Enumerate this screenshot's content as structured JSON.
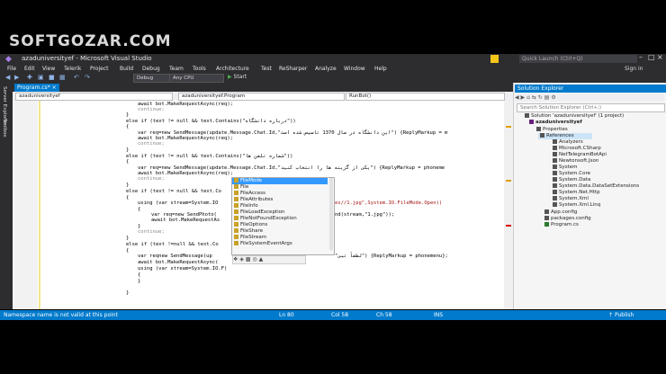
{
  "watermark": "SOFTGOZAR.COM",
  "window": {
    "title": "azaduniversityef - Microsoft Visual Studio",
    "quick_launch_placeholder": "Quick Launch (Ctrl+Q)",
    "sign_in": "Sign in"
  },
  "menu": [
    "File",
    "Edit",
    "View",
    "Telerik",
    "Project",
    "Build",
    "Debug",
    "Team",
    "Tools",
    "Architecture",
    "Test",
    "ReSharper",
    "Analyze",
    "Window",
    "Help"
  ],
  "toolbar": {
    "config": "Debug",
    "platform": "Any CPU",
    "start": "Start"
  },
  "side_tabs": [
    "Server Explorer",
    "Toolbox"
  ],
  "doc_tab": "Program.cs*",
  "nav": {
    "project": "azaduniversityef",
    "type": "azaduniversityef.Program",
    "member": "RunBot()"
  },
  "code_lines": [
    "await bot.MakeRequestAsync(req);",
    "continue;",
    "}",
    "else if (text != null && text.Contains(\"درباره دانشگاه\"))",
    "{",
    "var req=new SendMessage(update.Message.Chat.Id,\"این دانشگاه در سال 1370 تاسیس شده است\") {ReplyMarkup = m",
    "await bot.MakeRequestAsync(req);",
    "continue;",
    "}",
    "else if (text != null && text.Contains(\"شماره تلفن ها\"))",
    "{",
    "var req=new SendMessage(update.Message.Chat.Id,\"یکی از گزینه ها را انتخاب کنید\") {ReplyMarkup = phoneme",
    "await bot.MakeRequestAsync(req);",
    "continue;",
    "}",
    "else if (text != null && text.Co",
    "{",
    "using (var stream=System.IO",
    "{",
    "var req=new SendPhoto(",
    "await bot.MakeRequestAs",
    "}",
    "continue;",
    "}",
    "else if (text !=null && text.Co",
    "{",
    "var reqnew SendMessage(up",
    "await bot.MakeRequestAsync(",
    "using (var stream=System.IO.F)",
    "{",
    "}",
    "",
    "}"
  ],
  "code_tail": {
    "line17": "es//1.jpg\",System.IO.FileMode.Open))",
    "line19": "nd(stream,\"1.jpg\"));",
    "line26": "\"لطفاً تبی\") {ReplyMarkup = phonemenu};"
  },
  "intellisense": {
    "items": [
      "FileMode",
      "File",
      "FileAccess",
      "FileAttributes",
      "FileInfo",
      "FileLoadException",
      "FileNotFoundException",
      "FileOptions",
      "FileShare",
      "FileStream",
      "FileSystemEventArgs"
    ],
    "selected": "FileMode"
  },
  "solution_explorer": {
    "title": "Solution Explorer",
    "search_placeholder": "Search Solution Explorer (Ctrl+;)",
    "tree": [
      {
        "label": "Solution 'azaduniversityef' (1 project)",
        "level": 0
      },
      {
        "label": "azaduniversityef",
        "level": 1
      },
      {
        "label": "Properties",
        "level": 2
      },
      {
        "label": "References",
        "level": 2
      },
      {
        "label": "Analyzers",
        "level": 3
      },
      {
        "label": "Microsoft.CSharp",
        "level": 3
      },
      {
        "label": "NetTelegramBotApi",
        "level": 3
      },
      {
        "label": "Newtonsoft.Json",
        "level": 3
      },
      {
        "label": "System",
        "level": 3
      },
      {
        "label": "System.Core",
        "level": 3
      },
      {
        "label": "System.Data",
        "level": 3
      },
      {
        "label": "System.Data.DataSetExtensions",
        "level": 3
      },
      {
        "label": "System.Net.Http",
        "level": 3
      },
      {
        "label": "System.Xml",
        "level": 3
      },
      {
        "label": "System.Xml.Linq",
        "level": 3
      },
      {
        "label": "App.config",
        "level": 2
      },
      {
        "label": "packages.config",
        "level": 2
      },
      {
        "label": "Program.cs",
        "level": 2
      }
    ]
  },
  "status": {
    "message": "Namespace name is not valid at this point",
    "ln": "Ln 80",
    "col": "Col 58",
    "ch": "Ch 58",
    "mode": "INS",
    "publish": "Publish"
  }
}
